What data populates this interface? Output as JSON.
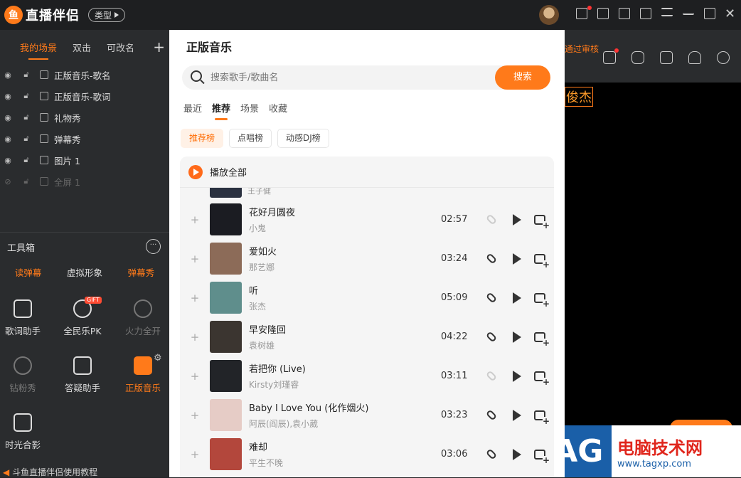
{
  "app": {
    "logo_text": "直播伴侣",
    "type_button": "类型"
  },
  "scenes": {
    "tabs": [
      "我的场景",
      "双击",
      "可改名"
    ],
    "add": "+"
  },
  "layers": [
    {
      "label": "正版音乐-歌名",
      "dim": false
    },
    {
      "label": "正版音乐-歌词",
      "dim": false
    },
    {
      "label": "礼物秀",
      "dim": false
    },
    {
      "label": "弹幕秀",
      "dim": false
    },
    {
      "label": "图片 1",
      "dim": false
    },
    {
      "label": "全屏 1",
      "dim": true
    }
  ],
  "toolbox": {
    "title": "工具箱",
    "more": "···",
    "tabs": [
      "读弹幕",
      "虚拟形象",
      "弹幕秀"
    ],
    "tools": [
      {
        "label": "歌词助手",
        "icon": "lyrics-icon",
        "dim": false
      },
      {
        "label": "全民乐PK",
        "icon": "pk-icon",
        "dim": false,
        "badge": "GIFT"
      },
      {
        "label": "火力全开",
        "icon": "download-icon",
        "dim": true
      },
      {
        "label": "钻粉秀",
        "icon": "download-icon",
        "dim": true
      },
      {
        "label": "答疑助手",
        "icon": "bulb-icon",
        "dim": false
      },
      {
        "label": "正版音乐",
        "icon": "music-icon",
        "dim": false,
        "active": true
      },
      {
        "label": "时光合影",
        "icon": "photo-icon",
        "dim": false
      }
    ],
    "bottom_link": "斗鱼直播伴侣使用教程"
  },
  "right": {
    "notice": "通过审核",
    "canvas_name": "俊杰"
  },
  "watermark": {
    "tag": "TAG",
    "title": "电脑技术网",
    "url": "www.tagxp.com"
  },
  "music": {
    "title": "正版音乐",
    "search_placeholder": "搜索歌手/歌曲名",
    "search_button": "搜索",
    "categories": [
      "最近",
      "推荐",
      "场景",
      "收藏"
    ],
    "active_category": "推荐",
    "chips": [
      "推荐榜",
      "点唱榜",
      "动感DJ榜"
    ],
    "play_all": "播放全部",
    "partial_artist": "王子健",
    "songs": [
      {
        "title": "花好月圆夜",
        "artist": "小鬼",
        "duration": "02:57",
        "linked": false,
        "cover": "#1b1c22"
      },
      {
        "title": "爱如火",
        "artist": "那艺娜",
        "duration": "03:24",
        "linked": true,
        "cover": "#8c6b58"
      },
      {
        "title": "听",
        "artist": "张杰",
        "duration": "05:09",
        "linked": true,
        "cover": "#5f8e8c"
      },
      {
        "title": "早安隆回",
        "artist": "袁树雄",
        "duration": "04:22",
        "linked": true,
        "cover": "#3b3530"
      },
      {
        "title": "若把你 (Live)",
        "artist": "Kirsty刘瑾睿",
        "duration": "03:11",
        "linked": false,
        "cover": "#222428"
      },
      {
        "title": "Baby I Love You (化作烟火)",
        "artist": "阿辰(阎辰),袁小葳",
        "duration": "03:23",
        "linked": true,
        "cover": "#e6ccc6"
      },
      {
        "title": "难却",
        "artist": "平生不晚",
        "duration": "03:06",
        "linked": true,
        "cover": "#b3473c"
      }
    ]
  }
}
